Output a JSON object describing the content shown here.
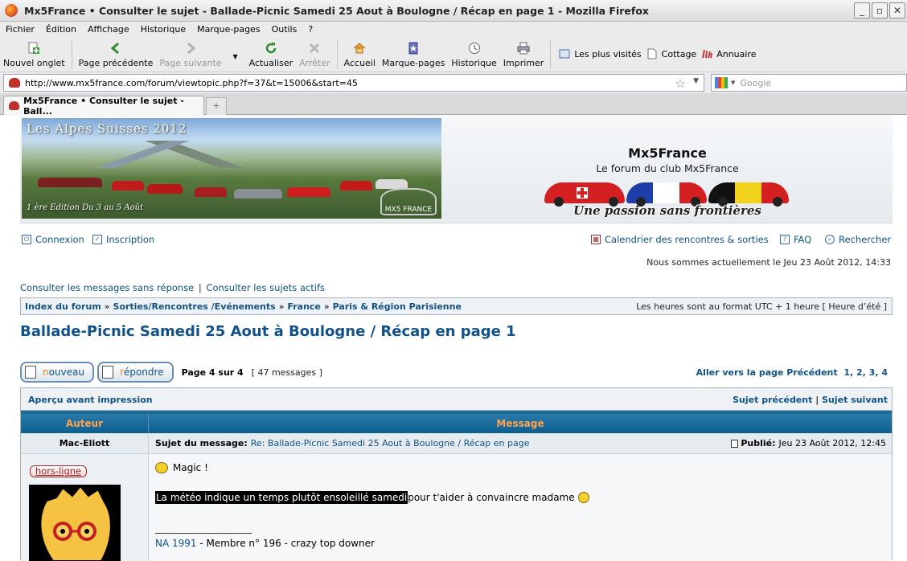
{
  "window": {
    "title": "Mx5France • Consulter le sujet - Ballade-Picnic Samedi 25 Aout à Boulogne / Récap en page 1 - Mozilla Firefox"
  },
  "menu": [
    "Fichier",
    "Édition",
    "Affichage",
    "Historique",
    "Marque-pages",
    "Outils",
    "?"
  ],
  "toolbar": {
    "new_tab": "Nouvel onglet",
    "back": "Page précédente",
    "forward": "Page suivante",
    "reload": "Actualiser",
    "stop": "Arrêter",
    "home": "Accueil",
    "bookmarks": "Marque-pages",
    "history": "Historique",
    "print": "Imprimer"
  },
  "bookmarks": [
    "Les plus visités",
    "Cottage",
    "Annuaire"
  ],
  "address": {
    "url": "http://www.mx5france.com/forum/viewtopic.php?f=37&t=15006&start=45",
    "search_placeholder": "Google"
  },
  "tab": {
    "label": "Mx5France • Consulter le sujet - Ball...",
    "new_tab_symbol": "+"
  },
  "header": {
    "banner_title": "Les Alpes Suisses 2012",
    "banner_subtitle": "1 ère Edition Du 3 au 5 Août",
    "site_name": "Mx5France",
    "site_desc": "Le forum du club Mx5France",
    "slogan": "Une passion sans frontières",
    "logo_text": "MX5 FRANCE"
  },
  "nav": {
    "login": "Connexion",
    "register": "Inscription",
    "calendar": "Calendrier des rencontres & sorties",
    "faq": "FAQ",
    "search": "Rechercher"
  },
  "date_line": "Nous sommes actuellement le Jeu 23 Août 2012, 14:33",
  "quick": {
    "unanswered": "Consulter les messages sans réponse",
    "separator": "|",
    "active": "Consulter les sujets actifs"
  },
  "breadcrumb": {
    "items": [
      "Index du forum",
      "Sorties/Rencontres /Evénements",
      "France",
      "Paris & Région Parisienne"
    ],
    "sep": "»",
    "timezone": "Les heures sont au format UTC + 1 heure [ Heure d’été ]"
  },
  "topic_title": "Ballade-Picnic Samedi 25 Aout à Boulogne / Récap en page 1",
  "buttons": {
    "new_first": "n",
    "new_rest": "ouveau",
    "reply_first": "r",
    "reply_rest": "épondre"
  },
  "pagination": {
    "page_info": "Page 4 sur 4",
    "count": "[ 47 messages ]",
    "goto": "Aller vers la page",
    "prev": "Précédent",
    "pages": [
      "1",
      "2",
      "3",
      "4"
    ]
  },
  "topic_bar": {
    "print": "Aperçu avant impression",
    "prev_topic": "Sujet précédent",
    "sep": "|",
    "next_topic": "Sujet suivant"
  },
  "table": {
    "col_author": "Auteur",
    "col_message": "Message"
  },
  "post": {
    "author": "Mac-Eliott",
    "subject_label": "Sujet du message:",
    "subject": "Re: Ballade-Picnic Samedi 25 Aout à Boulogne / Récap en page",
    "posted_label": "Publié:",
    "posted": "Jeu 23 Août 2012, 12:45",
    "status": "hors-ligne",
    "line1": "Magic !",
    "line2_highlight": "La météo indique un temps plutôt ensoleillé samedi",
    "line2_rest": " pour t'aider à convaincre madame",
    "sig_link": "NA 1991",
    "sig_rest": " - Membre n° 196 - crazy top downer"
  },
  "colors": {
    "link": "#105289",
    "header_bar": "#0d5f8f",
    "header_text": "#ffa34f"
  }
}
